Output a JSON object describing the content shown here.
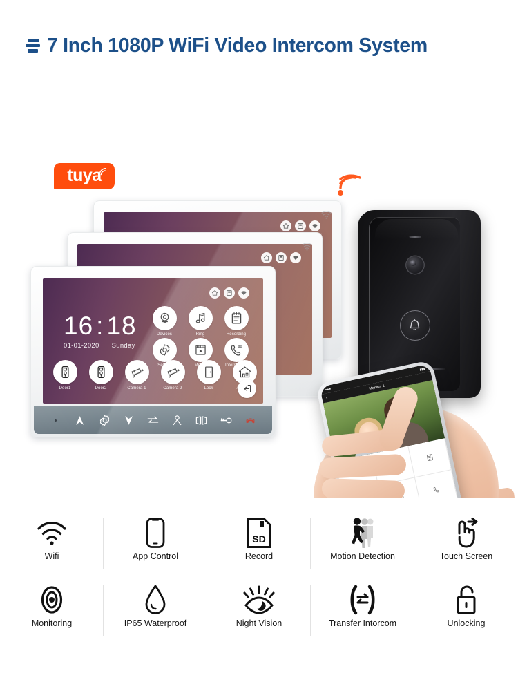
{
  "header": {
    "title": "7 Inch 1080P WiFi Video Intercom System",
    "mark_icon": "bars-icon",
    "accent_color": "#1d5089"
  },
  "branding": {
    "tuya_label": "tuya",
    "tuya_color": "#ff4d0d",
    "wifi_icon": "wifi-icon"
  },
  "signals": {
    "wifi_a": "wifi-signal-icon",
    "wifi_b": "wifi-signal-icon",
    "wifi_c": "wifi-signal-icon",
    "color": "#ff5a1f"
  },
  "monitor": {
    "screen_gradient_from": "#4d2b52",
    "screen_gradient_to": "#a06a57",
    "status_icons": [
      "home-icon",
      "sd-card-icon",
      "wifi-icon"
    ],
    "bezel_wifi_icon": "wifi-icon",
    "clock": {
      "hours": "16",
      "colon": ":",
      "minutes": "18",
      "date": "01-01-2020",
      "weekday": "Sunday"
    },
    "menu_main": [
      {
        "label": "Devices",
        "icon": "camera-device-icon"
      },
      {
        "label": "Ring",
        "icon": "music-note-icon"
      },
      {
        "label": "Recording",
        "icon": "document-list-icon"
      },
      {
        "label": "Setting",
        "icon": "gear-icon"
      },
      {
        "label": "Media",
        "icon": "media-play-icon"
      },
      {
        "label": "Internal call",
        "icon": "phone-handset-icon"
      }
    ],
    "menu_bottom": [
      {
        "label": "Door1",
        "icon": "door-station-icon"
      },
      {
        "label": "Door2",
        "icon": "door-station-icon"
      },
      {
        "label": "Camera 1",
        "icon": "cctv-camera-icon"
      },
      {
        "label": "Camera 2",
        "icon": "cctv-camera-icon"
      },
      {
        "label": "Lock",
        "icon": "door-lock-icon"
      },
      {
        "label": "At home",
        "icon": "home-house-icon"
      }
    ],
    "exit_icon": "exit-logout-icon",
    "bezel_buttons": [
      "indicator-dot",
      "chevron-up-icon",
      "gear-icon",
      "chevron-down-icon",
      "transfer-arrows-icon",
      "person-icon",
      "camera-switch-icon",
      "key-unlock-icon",
      "phone-hangup-icon"
    ],
    "bezel_color": "#6d7c85",
    "phone_button_color": "#c0392b"
  },
  "doorbell": {
    "mic_label": "microphone-slot",
    "lens_icon": "camera-lens-icon",
    "bell_icon": "bell-icon",
    "speaker_label": "speaker-slot",
    "body_color": "#1c1c1f"
  },
  "phone": {
    "status_left": "●●●",
    "status_right": "▮▮▮",
    "back_icon": "back-arrow-icon",
    "title": "Monitor 1",
    "controls": [
      "unlock-icon",
      "snapshot-icon",
      "record-icon",
      "mute-icon",
      "capture-icon",
      "hangup-icon"
    ]
  },
  "features": {
    "row1": [
      {
        "label": "Wifi",
        "icon": "wifi-icon"
      },
      {
        "label": "App Control",
        "icon": "smartphone-icon"
      },
      {
        "label": "Record",
        "icon": "sd-card-icon"
      },
      {
        "label": "Motion Detection",
        "icon": "walking-person-icon"
      },
      {
        "label": "Touch Screen",
        "icon": "touch-hand-icon"
      }
    ],
    "row2": [
      {
        "label": "Monitoring",
        "icon": "eye-monitor-icon"
      },
      {
        "label": "IP65 Waterproof",
        "icon": "water-drop-icon"
      },
      {
        "label": "Night Vision",
        "icon": "night-eye-icon"
      },
      {
        "label": "Transfer Intorcom",
        "icon": "transfer-icon"
      },
      {
        "label": "Unlocking",
        "icon": "open-padlock-icon"
      }
    ]
  }
}
